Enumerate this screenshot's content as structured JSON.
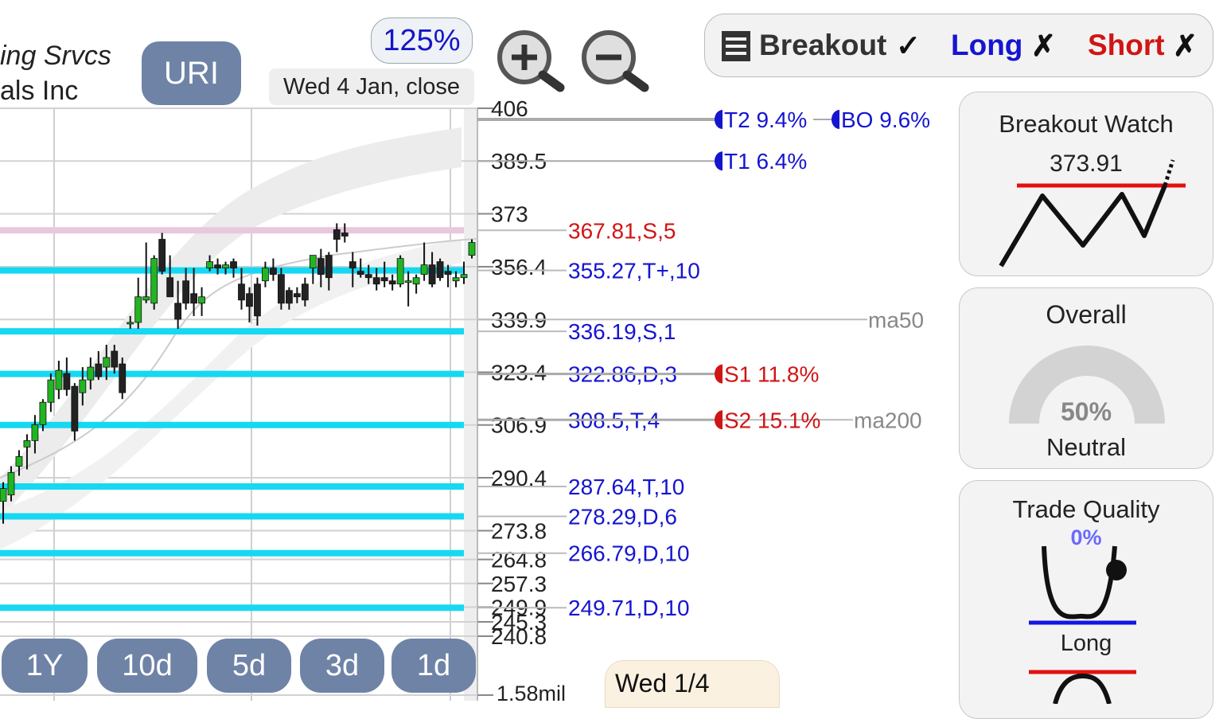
{
  "header": {
    "company_line1": "ing Srvcs",
    "company_line2": "als Inc",
    "ticker": "URI",
    "zoom": "125%",
    "date": "Wed 4 Jan, close"
  },
  "signals": {
    "breakout_label": "Breakout",
    "breakout_mark": "✓",
    "long_label": "Long",
    "long_mark": "✗",
    "short_label": "Short",
    "short_mark": "✗",
    "colors": {
      "breakout": "#333333",
      "long": "#1515d0",
      "short": "#d01515"
    }
  },
  "breakout_watch": {
    "title": "Breakout Watch",
    "value": "373.91"
  },
  "overall": {
    "title": "Overall",
    "percent": "50%",
    "fraction": 0.5,
    "label": "Neutral"
  },
  "trade_quality": {
    "title": "Trade Quality",
    "percent": "0%",
    "label": "Long"
  },
  "range_buttons": [
    "1Y",
    "10d",
    "5d",
    "3d",
    "1d"
  ],
  "bottom_date": "Wed 1/4",
  "chart_data": {
    "type": "candlestick",
    "ylim": [
      240.8,
      406
    ],
    "volume_label": "1.58mil",
    "y_ticks": [
      406,
      389.5,
      373,
      356.4,
      339.9,
      323.4,
      306.9,
      290.4,
      273.8,
      264.8,
      257.3,
      249.9,
      245.3,
      240.8
    ],
    "level_labels": [
      {
        "text": "367.81,S,5",
        "value": 367.81,
        "color": "#d01515"
      },
      {
        "text": "355.27,T+,10",
        "value": 355.27,
        "color": "#1515d0"
      },
      {
        "text": "336.19,S,1",
        "value": 336.19,
        "color": "#1515d0"
      },
      {
        "text": "322.86,D,3",
        "value": 322.86,
        "color": "#1515d0"
      },
      {
        "text": "308.5,T,4",
        "value": 308.5,
        "color": "#1515d0"
      },
      {
        "text": "287.64,T,10",
        "value": 287.64,
        "color": "#1515d0"
      },
      {
        "text": "278.29,D,6",
        "value": 278.29,
        "color": "#1515d0"
      },
      {
        "text": "266.79,D,10",
        "value": 266.79,
        "color": "#1515d0"
      },
      {
        "text": "249.71,D,10",
        "value": 249.71,
        "color": "#1515d0"
      }
    ],
    "targets": [
      {
        "text": "T2 9.4%",
        "value": 402.5,
        "color": "#1515d0"
      },
      {
        "text": "BO 9.6%",
        "value": 402.5,
        "color": "#1515d0"
      },
      {
        "text": "T1 6.4%",
        "value": 389.5,
        "color": "#1515d0"
      },
      {
        "text": "S1 11.8%",
        "value": 322.86,
        "color": "#d01515"
      },
      {
        "text": "S2 15.1%",
        "value": 308.5,
        "color": "#d01515"
      }
    ],
    "ma_labels": [
      {
        "text": "ma50",
        "value": 339.9
      },
      {
        "text": "ma200",
        "value": 308.5
      }
    ],
    "cyan_levels": [
      355.27,
      336.19,
      322.86,
      306.9,
      287.64,
      278.29,
      266.79,
      249.71
    ],
    "pink_level": 367.81,
    "candles": [
      {
        "o": 283,
        "h": 289,
        "l": 276,
        "c": 287
      },
      {
        "o": 285,
        "h": 294,
        "l": 283,
        "c": 292
      },
      {
        "o": 294,
        "h": 299,
        "l": 291,
        "c": 297
      },
      {
        "o": 300,
        "h": 304,
        "l": 293,
        "c": 302
      },
      {
        "o": 302,
        "h": 310,
        "l": 298,
        "c": 307
      },
      {
        "o": 307,
        "h": 315,
        "l": 305,
        "c": 314
      },
      {
        "o": 314,
        "h": 323,
        "l": 311,
        "c": 321
      },
      {
        "o": 318,
        "h": 327,
        "l": 315,
        "c": 324
      },
      {
        "o": 323,
        "h": 328,
        "l": 316,
        "c": 318
      },
      {
        "o": 319,
        "h": 320,
        "l": 302,
        "c": 305
      },
      {
        "o": 317,
        "h": 325,
        "l": 313,
        "c": 321
      },
      {
        "o": 321,
        "h": 328,
        "l": 318,
        "c": 325
      },
      {
        "o": 326,
        "h": 330,
        "l": 321,
        "c": 322
      },
      {
        "o": 325,
        "h": 332,
        "l": 321,
        "c": 328
      },
      {
        "o": 330,
        "h": 332,
        "l": 323,
        "c": 325
      },
      {
        "o": 326,
        "h": 328,
        "l": 315,
        "c": 317
      },
      {
        "o": 339,
        "h": 341,
        "l": 337,
        "c": 339
      },
      {
        "o": 339,
        "h": 353,
        "l": 337,
        "c": 347
      },
      {
        "o": 346,
        "h": 364,
        "l": 345,
        "c": 347
      },
      {
        "o": 345,
        "h": 360,
        "l": 343,
        "c": 359
      },
      {
        "o": 365,
        "h": 367,
        "l": 354,
        "c": 355
      },
      {
        "o": 353,
        "h": 360,
        "l": 347,
        "c": 347
      },
      {
        "o": 345,
        "h": 352,
        "l": 337,
        "c": 340
      },
      {
        "o": 352,
        "h": 356,
        "l": 343,
        "c": 345
      },
      {
        "o": 348,
        "h": 356,
        "l": 341,
        "c": 345
      },
      {
        "o": 345,
        "h": 350,
        "l": 341,
        "c": 347
      },
      {
        "o": 356,
        "h": 360,
        "l": 355,
        "c": 358
      },
      {
        "o": 357,
        "h": 359,
        "l": 354,
        "c": 356
      },
      {
        "o": 356,
        "h": 358,
        "l": 354,
        "c": 357
      },
      {
        "o": 358,
        "h": 359,
        "l": 353,
        "c": 356
      },
      {
        "o": 351,
        "h": 356,
        "l": 343,
        "c": 346
      },
      {
        "o": 348,
        "h": 350,
        "l": 339,
        "c": 344
      },
      {
        "o": 351,
        "h": 353,
        "l": 338,
        "c": 341
      },
      {
        "o": 352,
        "h": 358,
        "l": 350,
        "c": 356
      },
      {
        "o": 356,
        "h": 359,
        "l": 352,
        "c": 354
      },
      {
        "o": 354,
        "h": 356,
        "l": 343,
        "c": 345
      },
      {
        "o": 349,
        "h": 350,
        "l": 343,
        "c": 345
      },
      {
        "o": 348,
        "h": 350,
        "l": 345,
        "c": 347
      },
      {
        "o": 351,
        "h": 353,
        "l": 344,
        "c": 346
      },
      {
        "o": 356,
        "h": 360,
        "l": 351,
        "c": 360
      },
      {
        "o": 359,
        "h": 362,
        "l": 350,
        "c": 354
      },
      {
        "o": 360,
        "h": 361,
        "l": 349,
        "c": 353
      },
      {
        "o": 368,
        "h": 370,
        "l": 361,
        "c": 365
      },
      {
        "o": 367,
        "h": 370,
        "l": 364,
        "c": 366
      },
      {
        "o": 358,
        "h": 361,
        "l": 350,
        "c": 356
      },
      {
        "o": 355,
        "h": 359,
        "l": 353,
        "c": 354
      },
      {
        "o": 354,
        "h": 357,
        "l": 351,
        "c": 353
      },
      {
        "o": 353,
        "h": 356,
        "l": 349,
        "c": 351
      },
      {
        "o": 353,
        "h": 358,
        "l": 350,
        "c": 352
      },
      {
        "o": 352,
        "h": 354,
        "l": 349,
        "c": 351
      },
      {
        "o": 351,
        "h": 360,
        "l": 350,
        "c": 359
      },
      {
        "o": 352,
        "h": 355,
        "l": 344,
        "c": 352
      },
      {
        "o": 351,
        "h": 354,
        "l": 348,
        "c": 353
      },
      {
        "o": 354,
        "h": 364,
        "l": 352,
        "c": 357
      },
      {
        "o": 357,
        "h": 361,
        "l": 350,
        "c": 351
      },
      {
        "o": 358,
        "h": 359,
        "l": 352,
        "c": 353
      },
      {
        "o": 355,
        "h": 357,
        "l": 350,
        "c": 354
      },
      {
        "o": 352,
        "h": 355,
        "l": 350,
        "c": 353
      },
      {
        "o": 353,
        "h": 358,
        "l": 351,
        "c": 354
      },
      {
        "o": 360,
        "h": 365,
        "l": 359,
        "c": 364
      }
    ]
  }
}
